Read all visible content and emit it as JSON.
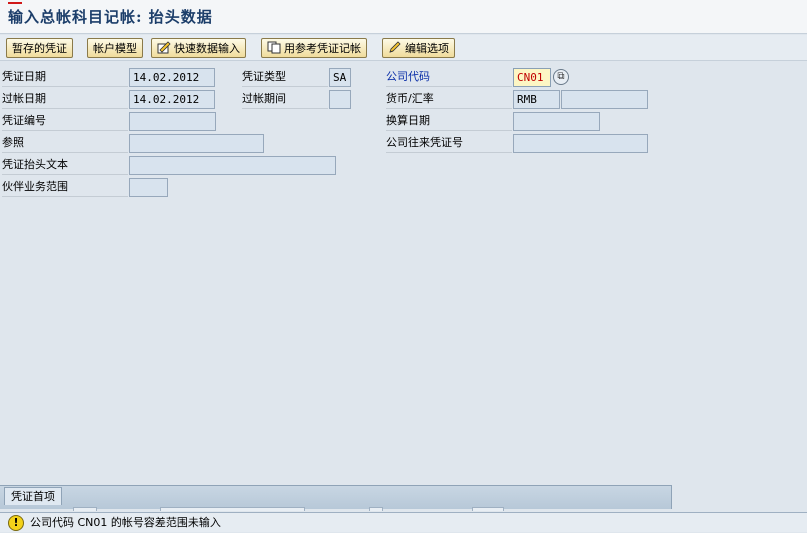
{
  "title": "输入总帐科目记帐: 抬头数据",
  "toolbar": {
    "held_doc": "暂存的凭证",
    "acct_model": "帐户模型",
    "fast_entry": "快速数据输入",
    "post_with_ref": "用参考凭证记帐",
    "edit_options": "编辑选项"
  },
  "form": {
    "doc_date_label": "凭证日期",
    "doc_date_value": "14.02.2012",
    "doc_type_label": "凭证类型",
    "doc_type_value": "SA",
    "company_code_label": "公司代码",
    "company_code_value": "CN01",
    "posting_date_label": "过帐日期",
    "posting_date_value": "14.02.2012",
    "period_label": "过帐期间",
    "period_value": "",
    "currency_label": "货币/汇率",
    "currency_value": "RMB",
    "exchange_rate_value": "",
    "doc_number_label": "凭证编号",
    "doc_number_value": "",
    "translation_date_label": "换算日期",
    "translation_date_value": "",
    "reference_label": "参照",
    "reference_value": "",
    "cross_cc_label": "公司往来凭证号",
    "cross_cc_value": "",
    "header_text_label": "凭证抬头文本",
    "header_text_value": "",
    "partner_ba_label": "伙伴业务范围",
    "partner_ba_value": ""
  },
  "tab": {
    "label": "凭证首项"
  },
  "status": {
    "icon": "warning-icon",
    "message": "公司代码 CN01 的帐号容差范围未输入"
  },
  "colors": {
    "background": "#dfe6ed",
    "field": "#d8e3ee",
    "required_field": "#fdf6c4",
    "title": "#1c3e6a",
    "link_label": "#0a2ea8"
  }
}
